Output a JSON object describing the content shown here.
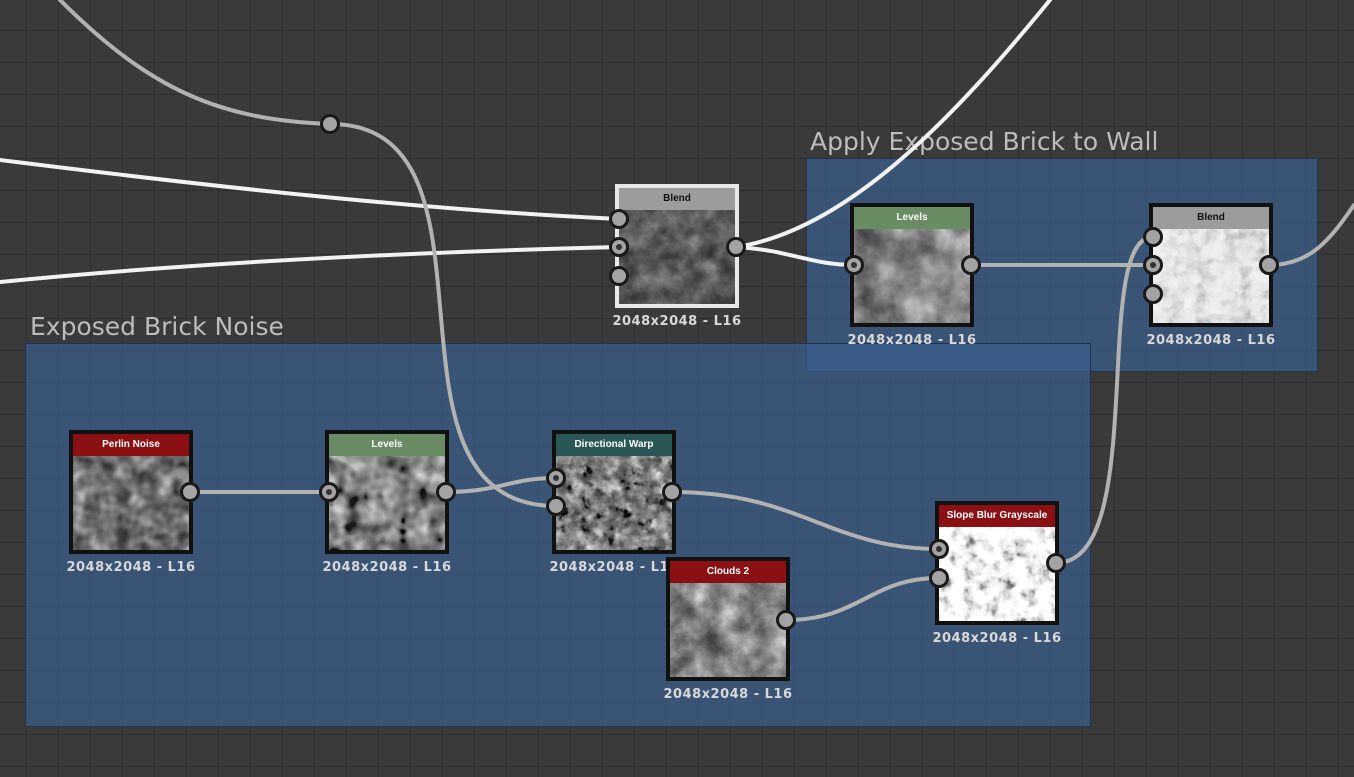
{
  "frames": {
    "brick_to_wall": {
      "title": "Apply Exposed Brick to Wall"
    },
    "brick_noise": {
      "title": "Exposed Brick Noise"
    }
  },
  "nodes": {
    "blend_top": {
      "title": "Blend",
      "resolution": "2048x2048 - L16"
    },
    "levels_wall": {
      "title": "Levels",
      "resolution": "2048x2048 - L16"
    },
    "blend_wall": {
      "title": "Blend",
      "resolution": "2048x2048 - L16"
    },
    "perlin_noise": {
      "title": "Perlin Noise",
      "resolution": "2048x2048 - L16"
    },
    "levels_noise": {
      "title": "Levels",
      "resolution": "2048x2048 - L16"
    },
    "directional_warp": {
      "title": "Directional Warp",
      "resolution": "2048x2048 - L16"
    },
    "clouds_2": {
      "title": "Clouds 2",
      "resolution": "2048x2048 - L16"
    },
    "slope_blur": {
      "title": "Slope Blur Grayscale",
      "resolution": "2048x2048 - L16"
    }
  },
  "colors": {
    "header_generator": "#8b1014",
    "header_adjust": "#6a8c64",
    "header_filter": "#2b5656",
    "header_blend": "#9c9c9c",
    "frame_fill": "#3a5e8c"
  }
}
